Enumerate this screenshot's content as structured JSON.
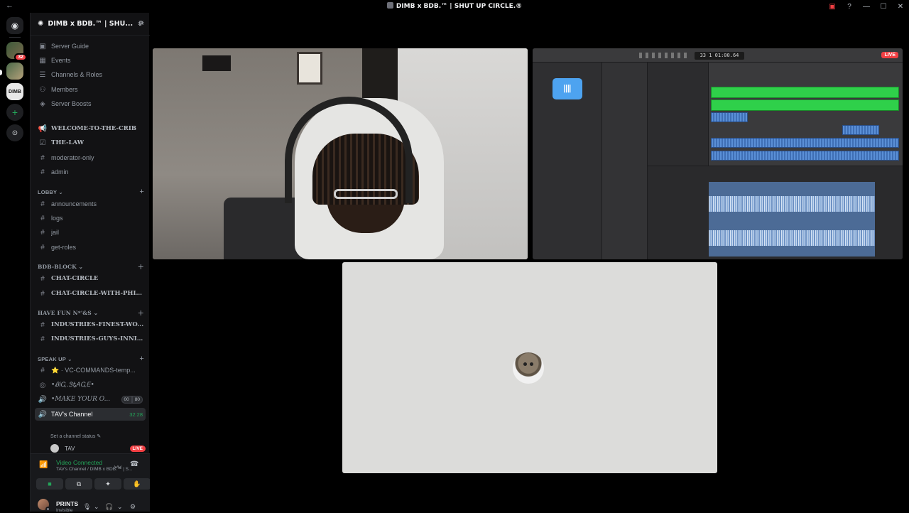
{
  "window": {
    "title": "DIMB x BDB.™ | SHUT UP CIRCLE.®",
    "back_glyph": "←",
    "controls": [
      "▣",
      "?",
      "—",
      "☐",
      "✕"
    ]
  },
  "rail": {
    "discord_glyph": "◉",
    "server1_badge": "32",
    "server3_label": "DIMB",
    "add_glyph": "+",
    "explore_glyph": "⊙"
  },
  "server": {
    "name": "DIMB x BDB.™ | SHU...",
    "chevron": "⌄",
    "invite_glyph": "⛯"
  },
  "top_items": [
    {
      "icon": "▣",
      "label": "Server Guide"
    },
    {
      "icon": "▦",
      "label": "Events"
    },
    {
      "icon": "☰",
      "label": "Channels & Roles"
    },
    {
      "icon": "⚇",
      "label": "Members"
    },
    {
      "icon": "◈",
      "label": "Server Boosts"
    }
  ],
  "channels_top": [
    {
      "icon": "📢",
      "label": "WELCOME-TO-THE-CRIB"
    },
    {
      "icon": "☑",
      "label": "THE-LAW"
    },
    {
      "icon": "#",
      "label": "moderator-only"
    },
    {
      "icon": "#",
      "label": "admin"
    }
  ],
  "categories": {
    "lobby": "LOBBY ⌄",
    "bdb_block": "BDB-BLOCK ⌄",
    "have_fun": "HAVE FUN N*'&S ⌄",
    "speak_up": "SPEAK UP ⌄",
    "plus": "+"
  },
  "lobby_channels": [
    {
      "icon": "#",
      "label": "announcements"
    },
    {
      "icon": "#",
      "label": "logs"
    },
    {
      "icon": "#",
      "label": "jail"
    },
    {
      "icon": "#",
      "label": "get-roles"
    }
  ],
  "bdb_channels": [
    {
      "icon": "#",
      "label": "CHAT-CIRCLE"
    },
    {
      "icon": "#",
      "label": "CHAT-CIRCLE-WITH-PHIL..."
    }
  ],
  "fun_channels": [
    {
      "icon": "#",
      "label": "INDUSTRIES-FINEST-WO..."
    },
    {
      "icon": "#",
      "label": "INDUSTRIES-GUYS-INNIT..."
    }
  ],
  "speak_channels": [
    {
      "icon": "#",
      "label": "⭐ · VC-COMMANDS-temp..."
    },
    {
      "icon": "◎",
      "label": "•ᏰᎥᏩ.ᏕᎿᎪᏩᎬ•"
    },
    {
      "icon": "🔊",
      "label": "•MAKE YOUR O...",
      "pill": [
        "00",
        "80"
      ]
    }
  ],
  "active_channel": {
    "icon": "🔊",
    "label": "TAV's Channel",
    "timer": "32:28",
    "status": "Set a channel status ✎"
  },
  "voice_user": {
    "name": "TAV",
    "badge": "LIVE"
  },
  "voice_panel": {
    "signal_glyph": "📶",
    "title": "Video Connected",
    "subtitle": "TAV's Channel / DIMB x BDB.™ | S...",
    "noise_glyph": "〰",
    "hangup_glyph": "☎",
    "buttons": [
      "■",
      "⧉",
      "✦",
      "✋"
    ]
  },
  "user": {
    "name": "PRINTS",
    "status": "Invisible",
    "mic": "🎙",
    "mic_chev": "⌄",
    "headset": "🎧",
    "headset_chev": "⌄",
    "settings": "⚙"
  },
  "streams": {
    "screen_live": "LIVE",
    "daw_lcd": "33  1    01:00.64",
    "library_icon": "𝄃𝄃𝄃"
  },
  "colors": {
    "accent_green": "#23a559",
    "live_red": "#f23f43",
    "sidebar_bg": "#121214",
    "region_green": "#2fd04a",
    "region_blue": "#5a8fd6"
  }
}
